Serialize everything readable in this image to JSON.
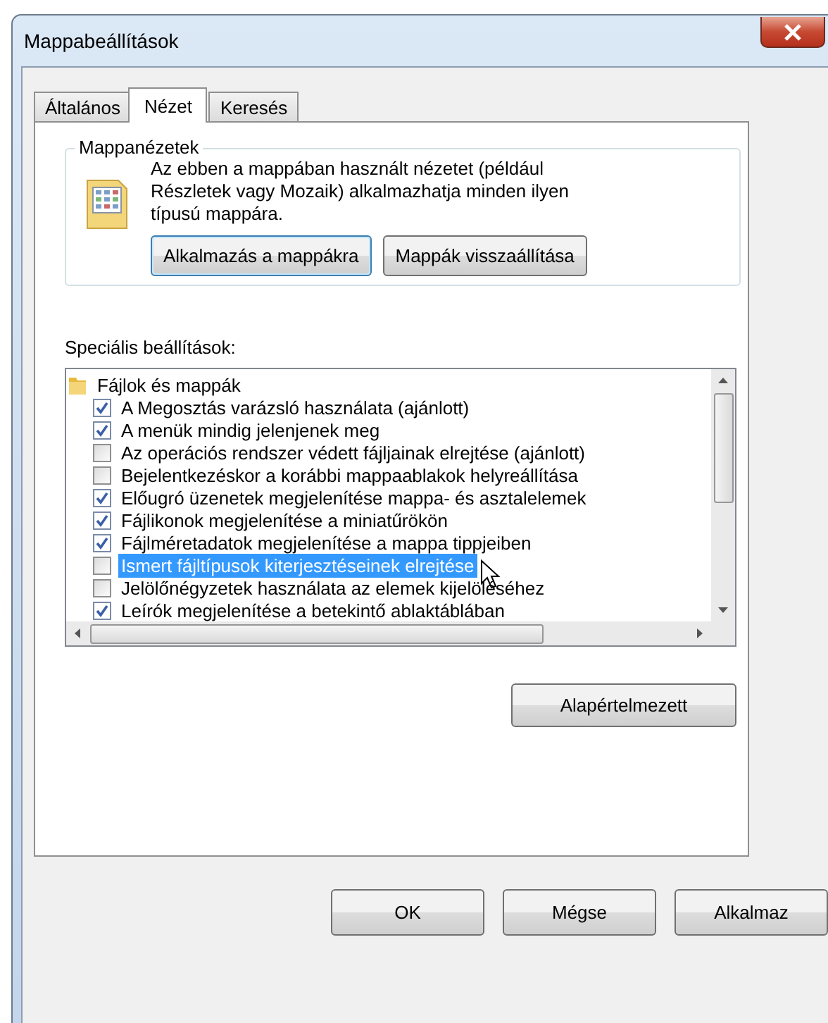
{
  "window": {
    "title": "Mappabeállítások"
  },
  "tabs": [
    {
      "label": "Általános",
      "selected": false
    },
    {
      "label": "Nézet",
      "selected": true
    },
    {
      "label": "Keresés",
      "selected": false
    }
  ],
  "folder_views": {
    "legend": "Mappanézetek",
    "description": "Az ebben a mappában használt nézetet (például Részletek vagy Mozaik) alkalmazhatja minden ilyen típusú mappára.",
    "buttons": [
      {
        "label": "Alkalmazás a mappákra",
        "focused": true
      },
      {
        "label": "Mappák visszaállítása",
        "focused": false
      }
    ]
  },
  "advanced": {
    "label": "Speciális beállítások:",
    "tree": {
      "label": "Fájlok és mappák",
      "children": [
        {
          "label": "A Megosztás varázsló használata (ajánlott)",
          "checked": true,
          "selected": false
        },
        {
          "label": "A menük mindig jelenjenek meg",
          "checked": true,
          "selected": false
        },
        {
          "label": "Az operációs rendszer védett fájljainak elrejtése (ajánlott)",
          "checked": false,
          "selected": false
        },
        {
          "label": "Bejelentkezéskor a korábbi mappaablakok helyreállítása",
          "checked": false,
          "selected": false
        },
        {
          "label": "Előugró üzenetek megjelenítése mappa- és asztalelemek",
          "checked": true,
          "selected": false
        },
        {
          "label": "Fájlikonok megjelenítése a miniatűrökön",
          "checked": true,
          "selected": false
        },
        {
          "label": "Fájlméretadatok megjelenítése a mappa tippjeiben",
          "checked": true,
          "selected": false
        },
        {
          "label": "Ismert fájltípusok kiterjesztéseinek elrejtése",
          "checked": false,
          "selected": true
        },
        {
          "label": "Jelölőnégyzetek használata az elemek kijelöléséhez",
          "checked": false,
          "selected": false
        },
        {
          "label": "Leírók megjelenítése a betekintő ablaktáblában",
          "checked": true,
          "selected": false
        }
      ]
    },
    "restore_button": "Alapértelmezett"
  },
  "buttons": [
    {
      "label": "OK"
    },
    {
      "label": "Mégse"
    },
    {
      "label": "Alkalmaz"
    }
  ]
}
